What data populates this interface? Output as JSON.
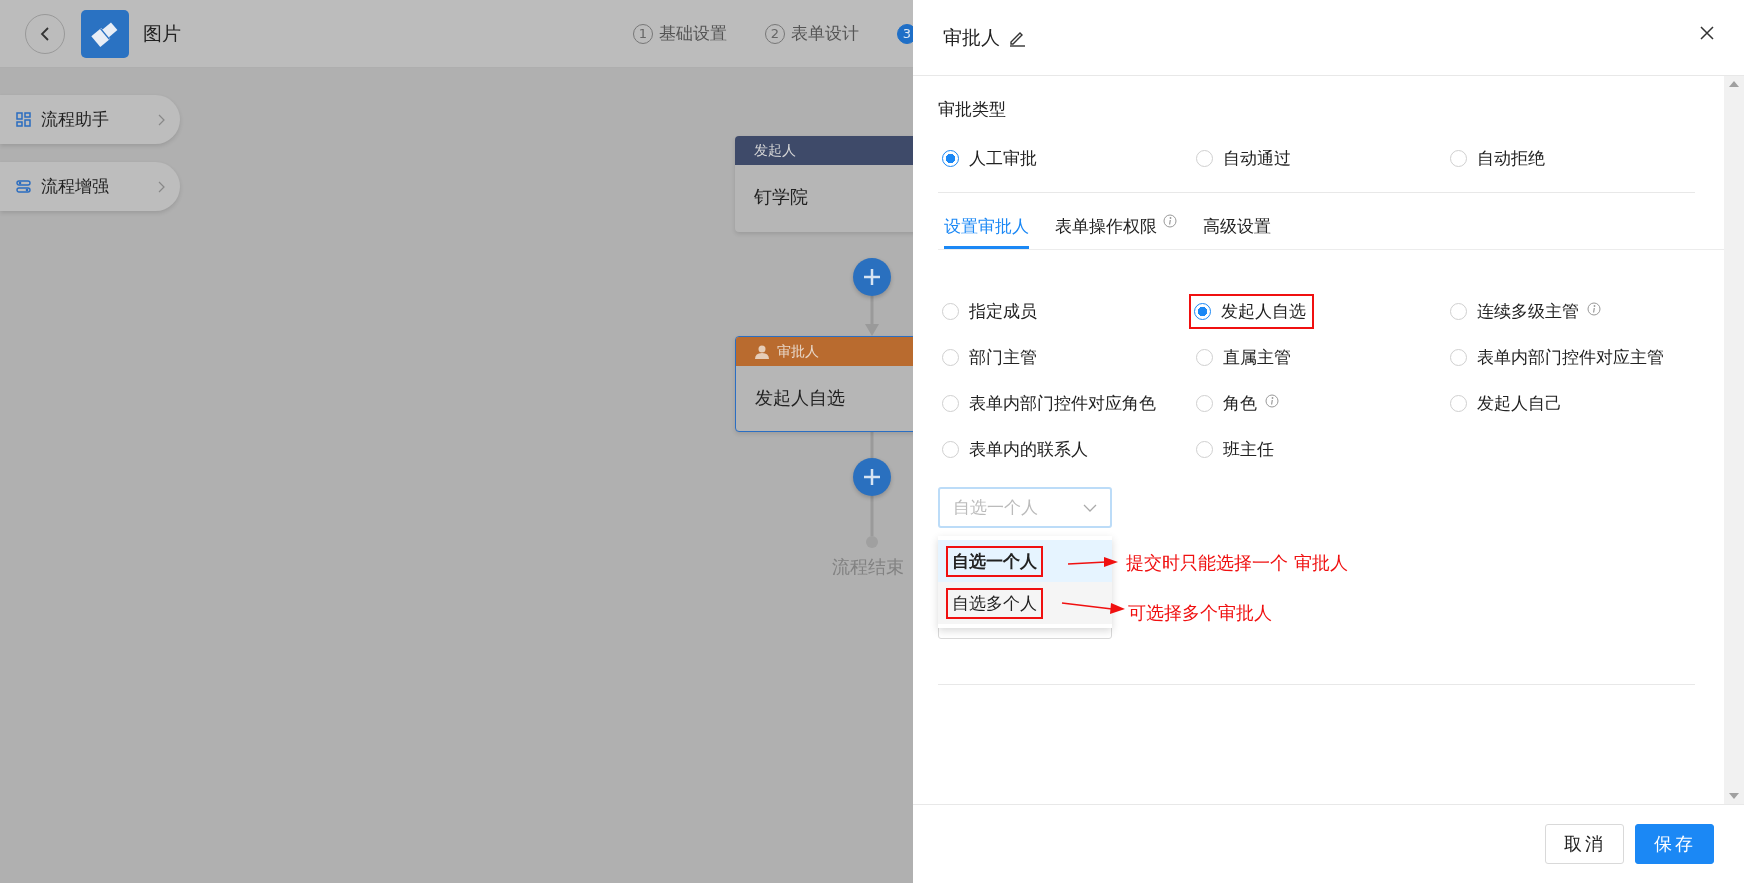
{
  "app_bar": {
    "title": "图片",
    "steps": [
      {
        "number": "1",
        "label": "基础设置",
        "selected": false
      },
      {
        "number": "2",
        "label": "表单设计",
        "selected": false
      },
      {
        "number": "3",
        "selected": true
      }
    ]
  },
  "sidebar": {
    "items": [
      {
        "label": "流程助手",
        "kind": "grid"
      },
      {
        "label": "流程增强",
        "kind": "sliders"
      }
    ]
  },
  "flow": {
    "nodes": [
      {
        "kind": "start",
        "header": "发起人",
        "body": "钉学院",
        "selected": false
      },
      {
        "kind": "approver",
        "header": "审批人",
        "body": "发起人自选",
        "selected": true
      }
    ],
    "end_label": "流程结束"
  },
  "panel": {
    "title": "审批人",
    "section_label": "审批类型",
    "approval_types": [
      {
        "label": "人工审批",
        "selected": true
      },
      {
        "label": "自动通过",
        "selected": false
      },
      {
        "label": "自动拒绝",
        "selected": false
      }
    ],
    "tabs": [
      {
        "label": "设置审批人",
        "selected": true,
        "info": false
      },
      {
        "label": "表单操作权限",
        "selected": false,
        "info": true
      },
      {
        "label": "高级设置",
        "selected": false,
        "info": false
      }
    ],
    "approver_options": [
      {
        "label": "指定成员",
        "selected": false,
        "info": false,
        "highlighted": false
      },
      {
        "label": "发起人自选",
        "selected": true,
        "info": false,
        "highlighted": true
      },
      {
        "label": "连续多级主管",
        "selected": false,
        "info": true,
        "highlighted": false
      },
      {
        "label": "部门主管",
        "selected": false,
        "info": false,
        "highlighted": false
      },
      {
        "label": "直属主管",
        "selected": false,
        "info": false,
        "highlighted": false
      },
      {
        "label": "表单内部门控件对应主管",
        "selected": false,
        "info": false,
        "highlighted": false
      },
      {
        "label": "表单内部门控件对应角色",
        "selected": false,
        "info": false,
        "highlighted": false
      },
      {
        "label": "角色",
        "selected": false,
        "info": true,
        "highlighted": false
      },
      {
        "label": "发起人自己",
        "selected": false,
        "info": false,
        "highlighted": false
      },
      {
        "label": "表单内的联系人",
        "selected": false,
        "info": false,
        "highlighted": false
      },
      {
        "label": "班主任",
        "selected": false,
        "info": false,
        "highlighted": false
      }
    ],
    "select": {
      "value": "自选一个人",
      "open": true,
      "options": [
        {
          "label": "自选一个人",
          "selected": true,
          "hovered": false,
          "highlighted": true
        },
        {
          "label": "自选多个人",
          "selected": false,
          "hovered": true,
          "highlighted": true
        }
      ]
    },
    "buttons": [
      {
        "label": "取消",
        "kind": "default"
      },
      {
        "label": "保存",
        "kind": "primary"
      }
    ]
  },
  "annotations": [
    {
      "text": "提交时只能选择一个 审批人"
    },
    {
      "text": "可选择多个审批人"
    }
  ]
}
